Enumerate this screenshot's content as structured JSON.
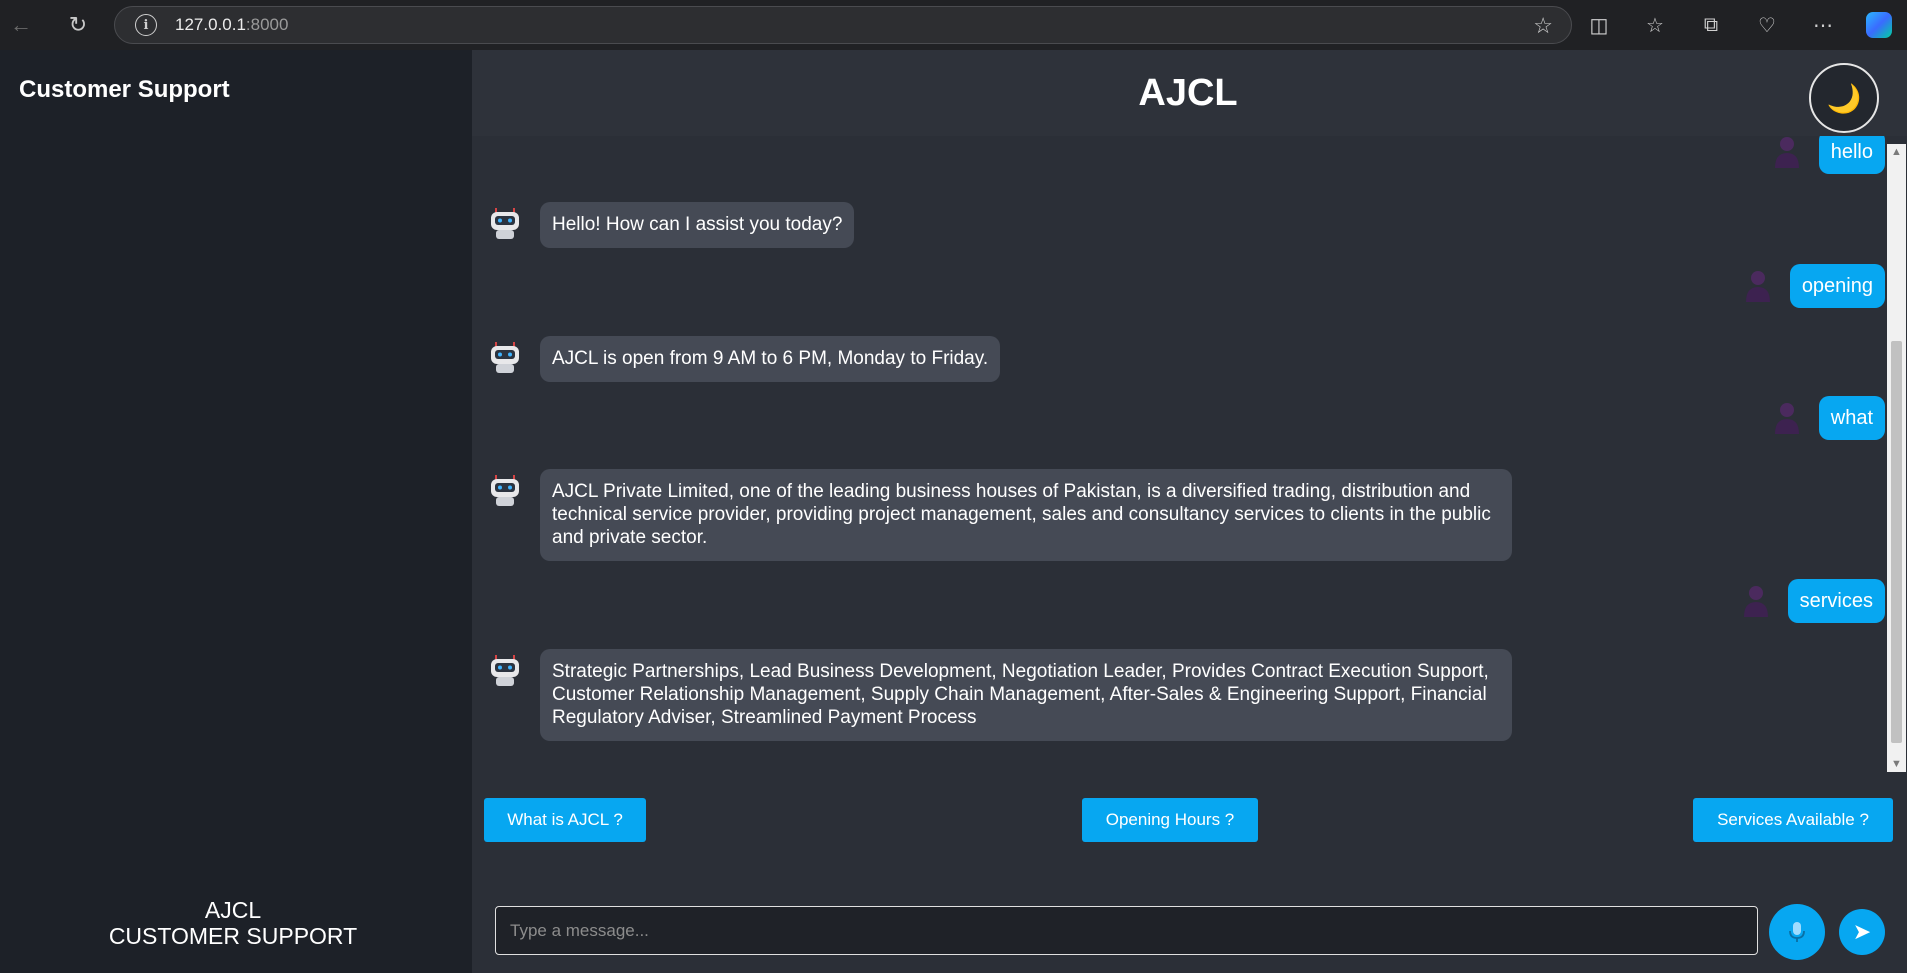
{
  "browser": {
    "url_host": "127.0.0.1",
    "url_port": ":8000",
    "info_icon": "i"
  },
  "sidebar": {
    "title": "Customer Support",
    "footer_line1": "AJCL",
    "footer_line2": "CUSTOMER SUPPORT"
  },
  "header": {
    "title": "AJCL",
    "theme_icon": "🌙"
  },
  "messages": [
    {
      "sender": "user",
      "text": "hello"
    },
    {
      "sender": "bot",
      "text": "Hello! How can I assist you today?"
    },
    {
      "sender": "user",
      "text": "opening"
    },
    {
      "sender": "bot",
      "text": "AJCL is open from 9 AM to 6 PM, Monday to Friday."
    },
    {
      "sender": "user",
      "text": "what"
    },
    {
      "sender": "bot",
      "text": "AJCL Private Limited, one of the leading business houses of Pakistan, is a diversified trading, distribution and technical service provider, providing project management, sales and consultancy services to clients in the public and private sector."
    },
    {
      "sender": "user",
      "text": "services"
    },
    {
      "sender": "bot",
      "text": "Strategic Partnerships, Lead Business Development, Negotiation Leader, Provides Contract Execution Support, Customer Relationship Management, Supply Chain Management, After-Sales & Engineering Support, Financial Regulatory Adviser, Streamlined Payment Process"
    }
  ],
  "quick_actions": [
    "What is AJCL ?",
    "Opening Hours ?",
    "Services Available ?"
  ],
  "input": {
    "placeholder": "Type a message...",
    "value": ""
  },
  "colors": {
    "accent": "#07a7f1",
    "sidebar_bg": "#1d2128",
    "main_bg": "#2b2f37",
    "bot_bubble": "#454a55"
  }
}
